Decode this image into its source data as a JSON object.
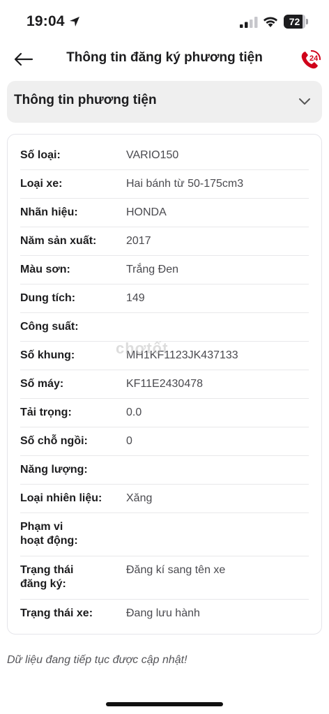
{
  "status_bar": {
    "time": "19:04",
    "battery": "72"
  },
  "nav": {
    "title": "Thông tin đăng ký phương tiện",
    "hotline_badge": "24"
  },
  "section": {
    "title": "Thông tin phương tiện"
  },
  "vehicle_info": [
    {
      "label": "Số loại:",
      "value": "VARIO150"
    },
    {
      "label": "Loại xe:",
      "value": "Hai bánh từ 50-175cm3"
    },
    {
      "label": "Nhãn hiệu:",
      "value": "HONDA"
    },
    {
      "label": "Năm sản xuất:",
      "value": "2017"
    },
    {
      "label": "Màu sơn:",
      "value": "Trắng Đen"
    },
    {
      "label": "Dung tích:",
      "value": "149"
    },
    {
      "label": "Công suất:",
      "value": ""
    },
    {
      "label": "Số khung:",
      "value": "MH1KF1123JK437133"
    },
    {
      "label": "Số máy:",
      "value": "KF11E2430478"
    },
    {
      "label": "Tải trọng:",
      "value": "0.0"
    },
    {
      "label": "Số chỗ ngồi:",
      "value": "0"
    },
    {
      "label": "Năng lượng:",
      "value": ""
    },
    {
      "label": "Loại nhiên liệu:",
      "value": "Xăng"
    },
    {
      "label": "Phạm vi\nhoạt động:",
      "value": ""
    },
    {
      "label": "Trạng thái\nđăng ký:",
      "value": "Đăng kí sang tên xe"
    },
    {
      "label": "Trạng thái xe:",
      "value": "Đang lưu hành"
    }
  ],
  "watermark": "chợtốt",
  "footnote": "Dữ liệu đang tiếp tục được cập nhật!",
  "colors": {
    "accent": "#d0021b",
    "section_bg": "#efefef",
    "divider": "#e8e8ea"
  }
}
